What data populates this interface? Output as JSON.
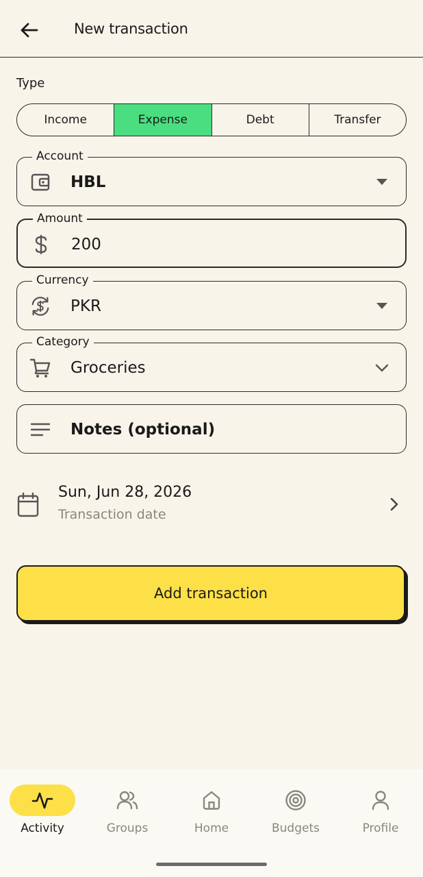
{
  "header": {
    "title": "New transaction"
  },
  "type_section": {
    "label": "Type",
    "options": [
      "Income",
      "Expense",
      "Debt",
      "Transfer"
    ],
    "selected": "Expense"
  },
  "fields": {
    "account": {
      "label": "Account",
      "value": "HBL",
      "icon": "wallet-icon"
    },
    "amount": {
      "label": "Amount",
      "value": "200",
      "icon": "dollar-icon"
    },
    "currency": {
      "label": "Currency",
      "value": "PKR",
      "icon": "currency-exchange-icon"
    },
    "category": {
      "label": "Category",
      "value": "Groceries",
      "icon": "cart-icon"
    },
    "notes": {
      "placeholder": "Notes (optional)",
      "icon": "notes-icon"
    }
  },
  "date": {
    "value": "Sun, Jun 28, 2026",
    "caption": "Transaction date"
  },
  "submit_label": "Add transaction",
  "nav": {
    "items": [
      {
        "label": "Activity",
        "icon": "activity-icon",
        "active": true
      },
      {
        "label": "Groups",
        "icon": "groups-icon",
        "active": false
      },
      {
        "label": "Home",
        "icon": "home-icon",
        "active": false
      },
      {
        "label": "Budgets",
        "icon": "target-icon",
        "active": false
      },
      {
        "label": "Profile",
        "icon": "person-icon",
        "active": false
      }
    ]
  },
  "colors": {
    "background": "#f8f4ea",
    "selected_segment": "#4ade80",
    "primary_button": "#fde047",
    "nav_active_pill": "#fde047"
  }
}
